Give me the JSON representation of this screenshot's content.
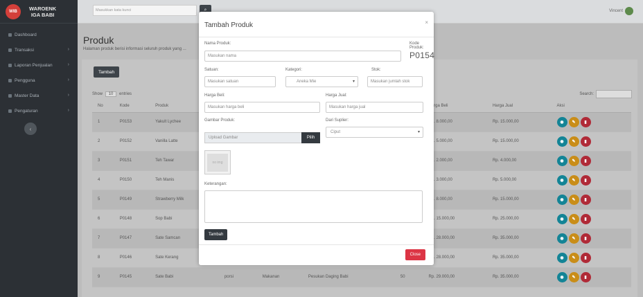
{
  "app": {
    "brand_line1": "WAROENK",
    "brand_line2": "IGA BABI",
    "logo_text": "WIB"
  },
  "sidebar": {
    "items": [
      {
        "label": "Dashboard",
        "chevron": false
      },
      {
        "label": "Transaksi",
        "chevron": true
      },
      {
        "label": "Laporan Penjualan",
        "chevron": true
      },
      {
        "label": "Pengguna",
        "chevron": true
      },
      {
        "label": "Master Data",
        "chevron": true
      },
      {
        "label": "Pengaturan",
        "chevron": true
      }
    ],
    "collapse_icon": "‹"
  },
  "topbar": {
    "search_placeholder": "Masukkan kata kunci",
    "search_icon": "⌕",
    "user_name": "Vincent"
  },
  "page": {
    "title": "Produk",
    "subtitle": "Halaman produk berisi informasi seluruh produk yang ..."
  },
  "list": {
    "add_label": "Tambah",
    "show_label": "Show",
    "show_value": "10",
    "entries_label": "entries",
    "search_label": "Search:",
    "columns": [
      "No",
      "Kode",
      "Produk",
      "Satuan",
      "Kategori",
      "Keterangan",
      "Stok",
      "Harga Beli",
      "Harga Jual",
      "Aksi"
    ],
    "rows": [
      {
        "no": "1",
        "kode": "P0153",
        "produk": "Yakult Lychee",
        "satuan": "",
        "kategori": "",
        "keterangan": "",
        "stok": "",
        "beli": "Rp. 8.000,00",
        "jual": "Rp. 15.000,00"
      },
      {
        "no": "2",
        "kode": "P0152",
        "produk": "Vanilla Latte",
        "satuan": "",
        "kategori": "",
        "keterangan": "",
        "stok": "",
        "beli": "Rp. 5.000,00",
        "jual": "Rp. 15.000,00"
      },
      {
        "no": "3",
        "kode": "P0151",
        "produk": "Teh Tawar",
        "satuan": "",
        "kategori": "",
        "keterangan": "",
        "stok": "",
        "beli": "Rp. 2.000,00",
        "jual": "Rp. 4.000,00"
      },
      {
        "no": "4",
        "kode": "P0150",
        "produk": "Teh Manis",
        "satuan": "",
        "kategori": "",
        "keterangan": "",
        "stok": "",
        "beli": "Rp. 3.000,00",
        "jual": "Rp. 5.000,00"
      },
      {
        "no": "5",
        "kode": "P0149",
        "produk": "Strawberry Milk",
        "satuan": "",
        "kategori": "",
        "keterangan": "",
        "stok": "",
        "beli": "Rp. 8.000,00",
        "jual": "Rp. 15.000,00"
      },
      {
        "no": "6",
        "kode": "P0148",
        "produk": "Sop Babi",
        "satuan": "",
        "kategori": "",
        "keterangan": "",
        "stok": "",
        "beli": "Rp. 15.000,00",
        "jual": "Rp. 25.000,00"
      },
      {
        "no": "7",
        "kode": "P0147",
        "produk": "Sate Samcan",
        "satuan": "",
        "kategori": "",
        "keterangan": "",
        "stok": "",
        "beli": "Rp. 28.000,00",
        "jual": "Rp. 35.000,00"
      },
      {
        "no": "8",
        "kode": "P0146",
        "produk": "Sate Kerang",
        "satuan": "",
        "kategori": "",
        "keterangan": "",
        "stok": "",
        "beli": "Rp. 28.000,00",
        "jual": "Rp. 35.000,00"
      },
      {
        "no": "9",
        "kode": "P0145",
        "produk": "Sate Babi",
        "satuan": "porsi",
        "kategori": "Makanan",
        "keterangan": "Pesukan Daging Babi",
        "stok": "50",
        "beli": "Rp. 29.000,00",
        "jual": "Rp. 35.000,00"
      }
    ],
    "action_icons": {
      "view": "◉",
      "edit": "✎",
      "delete": "▮"
    }
  },
  "modal": {
    "title": "Tambah Produk",
    "close_icon": "×",
    "nama_label": "Nama Produk:",
    "nama_placeholder": "Masukan nama",
    "kode_label": "Kode Produk:",
    "kode_value": "P0154",
    "satuan_label": "Satuan:",
    "satuan_placeholder": "Masukan satuan",
    "kategori_label": "Kategori:",
    "kategori_value": "Aneka Mie",
    "stok_label": "Stok:",
    "stok_placeholder": "Masukan jumlah stok",
    "beli_label": "Harga Beli:",
    "beli_placeholder": "Masukan harga beli",
    "jual_label": "Harga Jual:",
    "jual_placeholder": "Masukan harga jual",
    "gambar_label": "Gambar Produk:",
    "upload_placeholder": "Upload Gambar",
    "pilih_label": "Pilih",
    "thumb_text": "no img",
    "supplier_label": "Dari Suplier:",
    "supplier_value": "Ciput",
    "keterangan_label": "Keterangan:",
    "submit_label": "Tambah",
    "close_label": "Close"
  },
  "colors": {
    "overlay": "#808080",
    "sidebar": "#2c3035",
    "close_btn": "#dc3545"
  }
}
